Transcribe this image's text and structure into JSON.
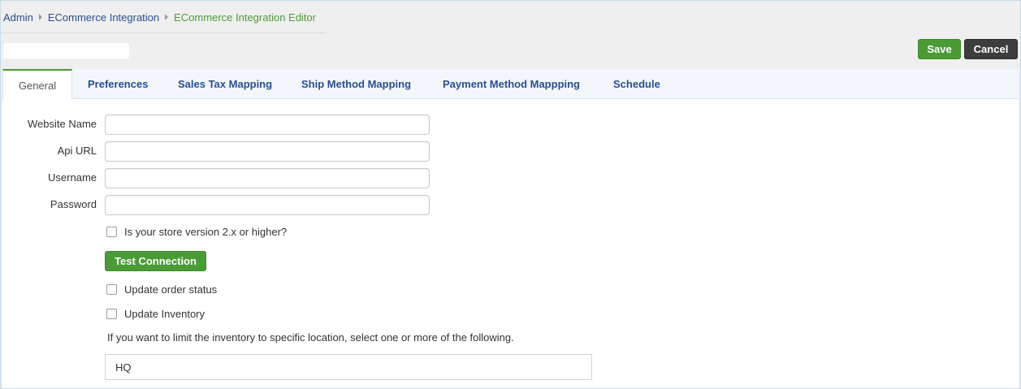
{
  "breadcrumb": {
    "items": [
      "Admin",
      "ECommerce Integration"
    ],
    "current": "ECommerce Integration Editor"
  },
  "toolbar": {
    "save_label": "Save",
    "cancel_label": "Cancel"
  },
  "tabs": [
    {
      "label": "General",
      "active": true
    },
    {
      "label": "Preferences"
    },
    {
      "label": "Sales Tax Mapping"
    },
    {
      "label": "Ship Method Mapping"
    },
    {
      "label": "Payment Method Mappping"
    },
    {
      "label": "Schedule"
    }
  ],
  "form": {
    "website_name": {
      "label": "Website Name",
      "value": ""
    },
    "api_url": {
      "label": "Api URL",
      "value": ""
    },
    "username": {
      "label": "Username",
      "value": ""
    },
    "password": {
      "label": "Password",
      "value": ""
    },
    "store_version_label": "Is your store version 2.x or higher?",
    "test_connection_label": "Test Connection",
    "update_order_status_label": "Update order status",
    "update_inventory_label": "Update Inventory",
    "inventory_hint": "If you want to limit the inventory to specific location, select one or more of the following.",
    "location_value": "HQ"
  },
  "colors": {
    "accent_green": "#4a9b35",
    "link_blue": "#2a4d8f",
    "cancel_dark": "#3d3d3d"
  }
}
